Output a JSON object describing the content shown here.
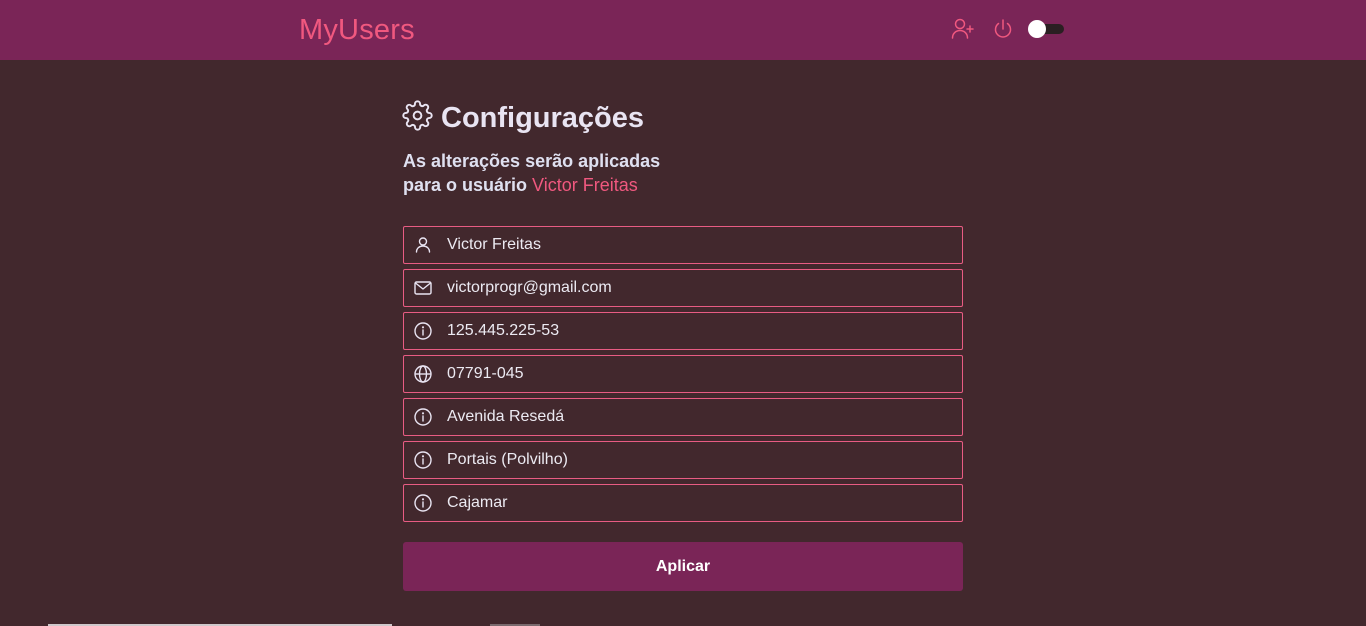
{
  "app": {
    "brand": "MyUsers"
  },
  "header": {
    "icons": [
      "add-user-icon",
      "power-icon"
    ],
    "theme_toggle_on": false
  },
  "page": {
    "title": "Configurações",
    "subtitle_line1": "As alterações serão aplicadas",
    "subtitle_line2_prefix": "para o usuário ",
    "subtitle_user": "Victor Freitas"
  },
  "form": {
    "fields": [
      {
        "icon": "user-icon",
        "value": "Victor Freitas"
      },
      {
        "icon": "mail-icon",
        "value": "victorprogr@gmail.com"
      },
      {
        "icon": "info-icon",
        "value": "125.445.225-53"
      },
      {
        "icon": "globe-icon",
        "value": "07791-045"
      },
      {
        "icon": "info-icon",
        "value": "Avenida Resedá"
      },
      {
        "icon": "info-icon",
        "value": "Portais (Polvilho)"
      },
      {
        "icon": "info-icon",
        "value": "Cajamar"
      }
    ],
    "submit_label": "Aplicar"
  },
  "colors": {
    "header_bg": "#7a2557",
    "page_bg": "#42282d",
    "accent": "#f0587f",
    "field_border": "#e85c83"
  }
}
